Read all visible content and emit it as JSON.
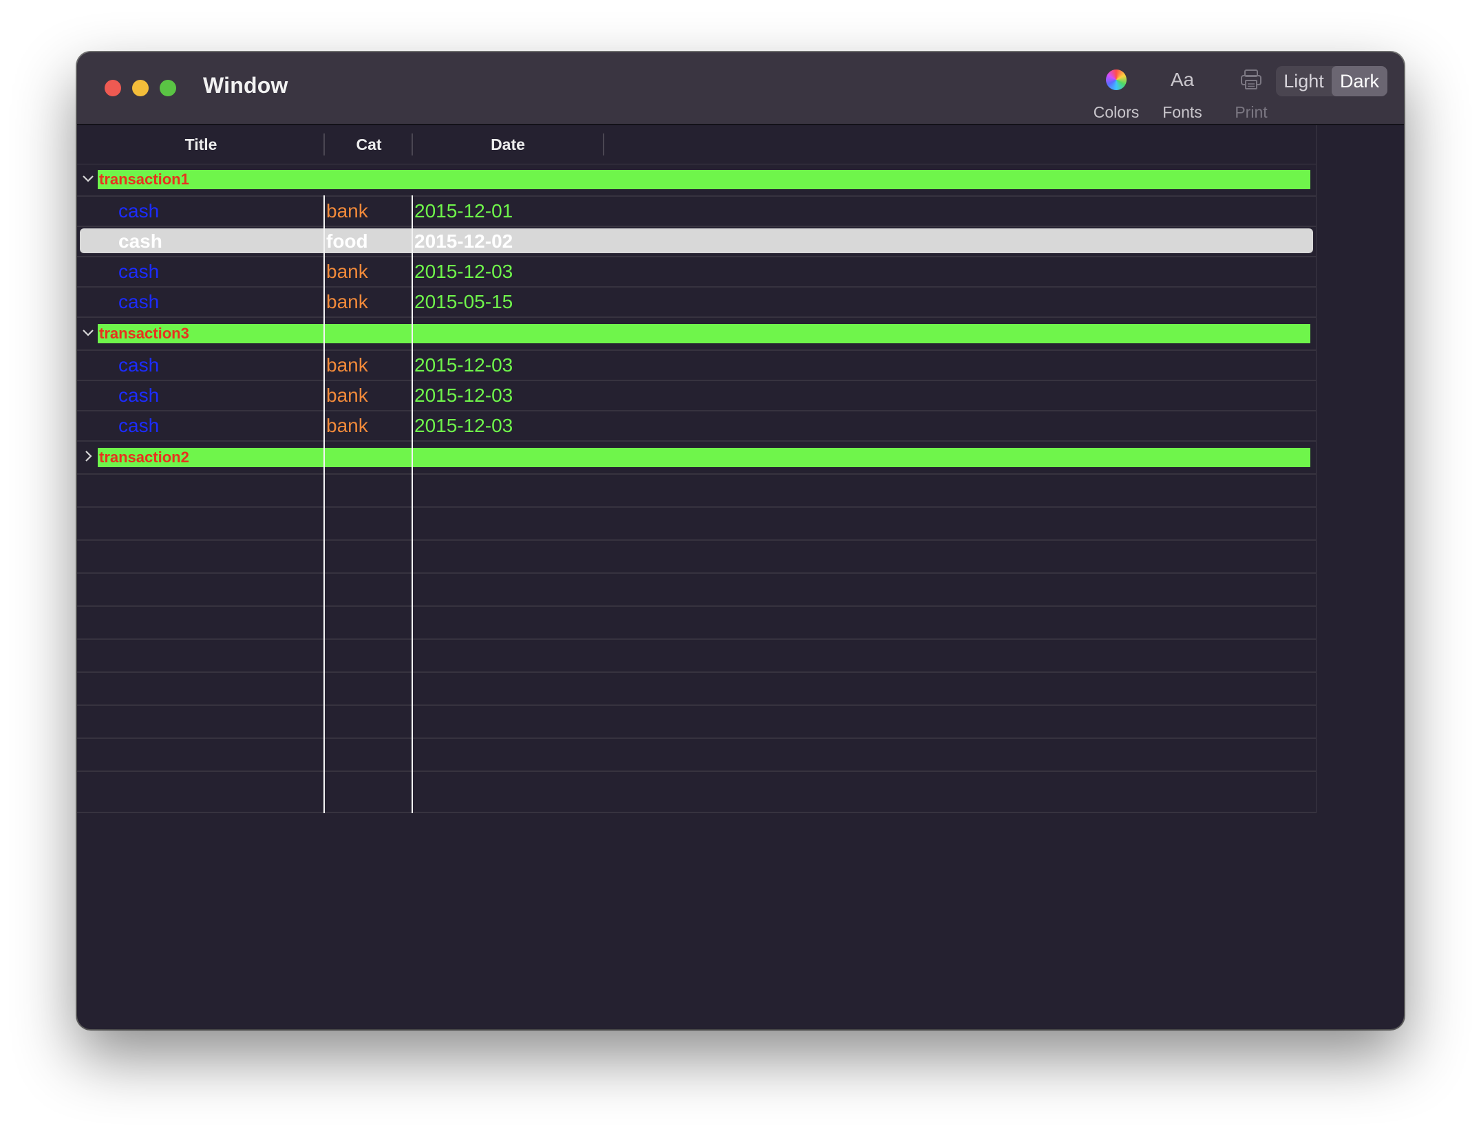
{
  "window": {
    "title": "Window"
  },
  "toolbar": {
    "colors": {
      "label": "Colors",
      "icon": "color-wheel-icon"
    },
    "fonts": {
      "label": "Fonts",
      "glyph": "Aa"
    },
    "print": {
      "label": "Print",
      "icon": "printer-icon"
    },
    "appearance": {
      "options": [
        "Light",
        "Dark"
      ],
      "selected": "Dark"
    }
  },
  "table": {
    "columns": [
      "Title",
      "Cat",
      "Date"
    ],
    "groups": [
      {
        "name": "transaction1",
        "expanded": true,
        "rows": [
          {
            "title": "cash",
            "cat": "bank",
            "date": "2015-12-01"
          },
          {
            "title": "cash",
            "cat": "food",
            "date": "2015-12-02",
            "selected": true
          },
          {
            "title": "cash",
            "cat": "bank",
            "date": "2015-12-03"
          },
          {
            "title": "cash",
            "cat": "bank",
            "date": "2015-05-15"
          }
        ]
      },
      {
        "name": "transaction3",
        "expanded": true,
        "rows": [
          {
            "title": "cash",
            "cat": "bank",
            "date": "2015-12-03"
          },
          {
            "title": "cash",
            "cat": "bank",
            "date": "2015-12-03"
          },
          {
            "title": "cash",
            "cat": "bank",
            "date": "2015-12-03"
          }
        ]
      },
      {
        "name": "transaction2",
        "expanded": false,
        "rows": []
      }
    ]
  },
  "colors": {
    "group_bar": "#6ff54b",
    "group_text": "#e8321e",
    "title_text": "#1c2cff",
    "cat_text": "#f28a3a",
    "date_text": "#6ff54b",
    "selection": "#d8d8d8"
  }
}
